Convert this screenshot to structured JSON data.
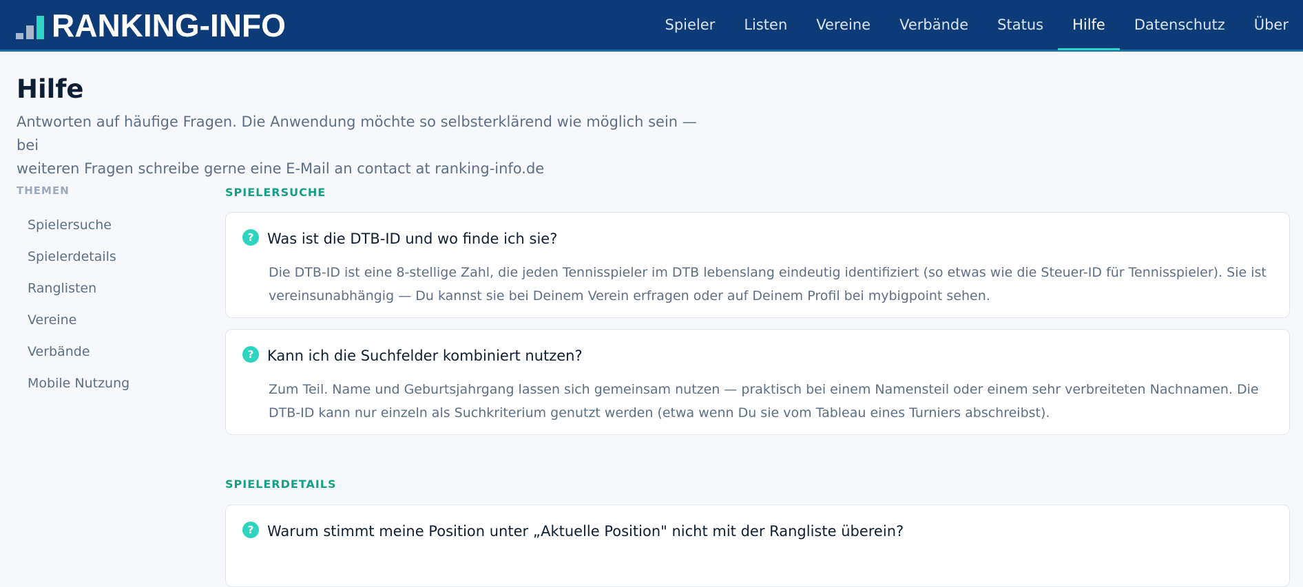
{
  "header": {
    "logo_text": "RANKING-INFO",
    "nav": [
      {
        "label": "Spieler",
        "active": false
      },
      {
        "label": "Listen",
        "active": false
      },
      {
        "label": "Vereine",
        "active": false
      },
      {
        "label": "Verbände",
        "active": false
      },
      {
        "label": "Status",
        "active": false
      },
      {
        "label": "Hilfe",
        "active": true
      },
      {
        "label": "Datenschutz",
        "active": false
      },
      {
        "label": "Über",
        "active": false
      }
    ]
  },
  "page": {
    "title": "Hilfe",
    "intro_line1": "Antworten auf häufige Fragen. Die Anwendung möchte so selbsterklärend wie möglich sein — bei",
    "intro_line2": "weiteren Fragen schreibe gerne eine E-Mail an contact at ranking-info.de"
  },
  "sidebar": {
    "heading": "THEMEN",
    "topics": [
      "Spielersuche",
      "Spielerdetails",
      "Ranglisten",
      "Vereine",
      "Verbände",
      "Mobile Nutzung"
    ]
  },
  "sections": [
    {
      "label": "SPIELERSUCHE",
      "questions": [
        {
          "icon": "question-icon",
          "icon_glyph": "?",
          "question": "Was ist die DTB-ID und wo finde ich sie?",
          "answer": "Die DTB-ID ist eine 8-stellige Zahl, die jeden Tennisspieler im DTB lebenslang eindeutig identifiziert (so etwas wie die Steuer-ID für Tennisspieler). Sie ist vereinsunabhängig — Du kannst sie bei Deinem Verein erfragen oder auf Deinem Profil bei mybigpoint sehen."
        },
        {
          "icon": "question-icon",
          "icon_glyph": "?",
          "question": "Kann ich die Suchfelder kombiniert nutzen?",
          "answer": "Zum Teil. Name und Geburtsjahrgang lassen sich gemeinsam nutzen — praktisch bei einem Namensteil oder einem sehr verbreiteten Nachnamen. Die DTB-ID kann nur einzeln als Suchkriterium genutzt werden (etwa wenn Du sie vom Tableau eines Turniers abschreibst)."
        }
      ]
    },
    {
      "label": "SPIELERDETAILS",
      "questions": [
        {
          "icon": "question-icon",
          "icon_glyph": "?",
          "question": "Warum stimmt meine Position unter „Aktuelle Position\" nicht mit der Rangliste überein?"
        }
      ]
    }
  ],
  "colors": {
    "header_bg": "#0c3b78",
    "accent": "#2dd4bf",
    "section_label": "#14a085"
  }
}
